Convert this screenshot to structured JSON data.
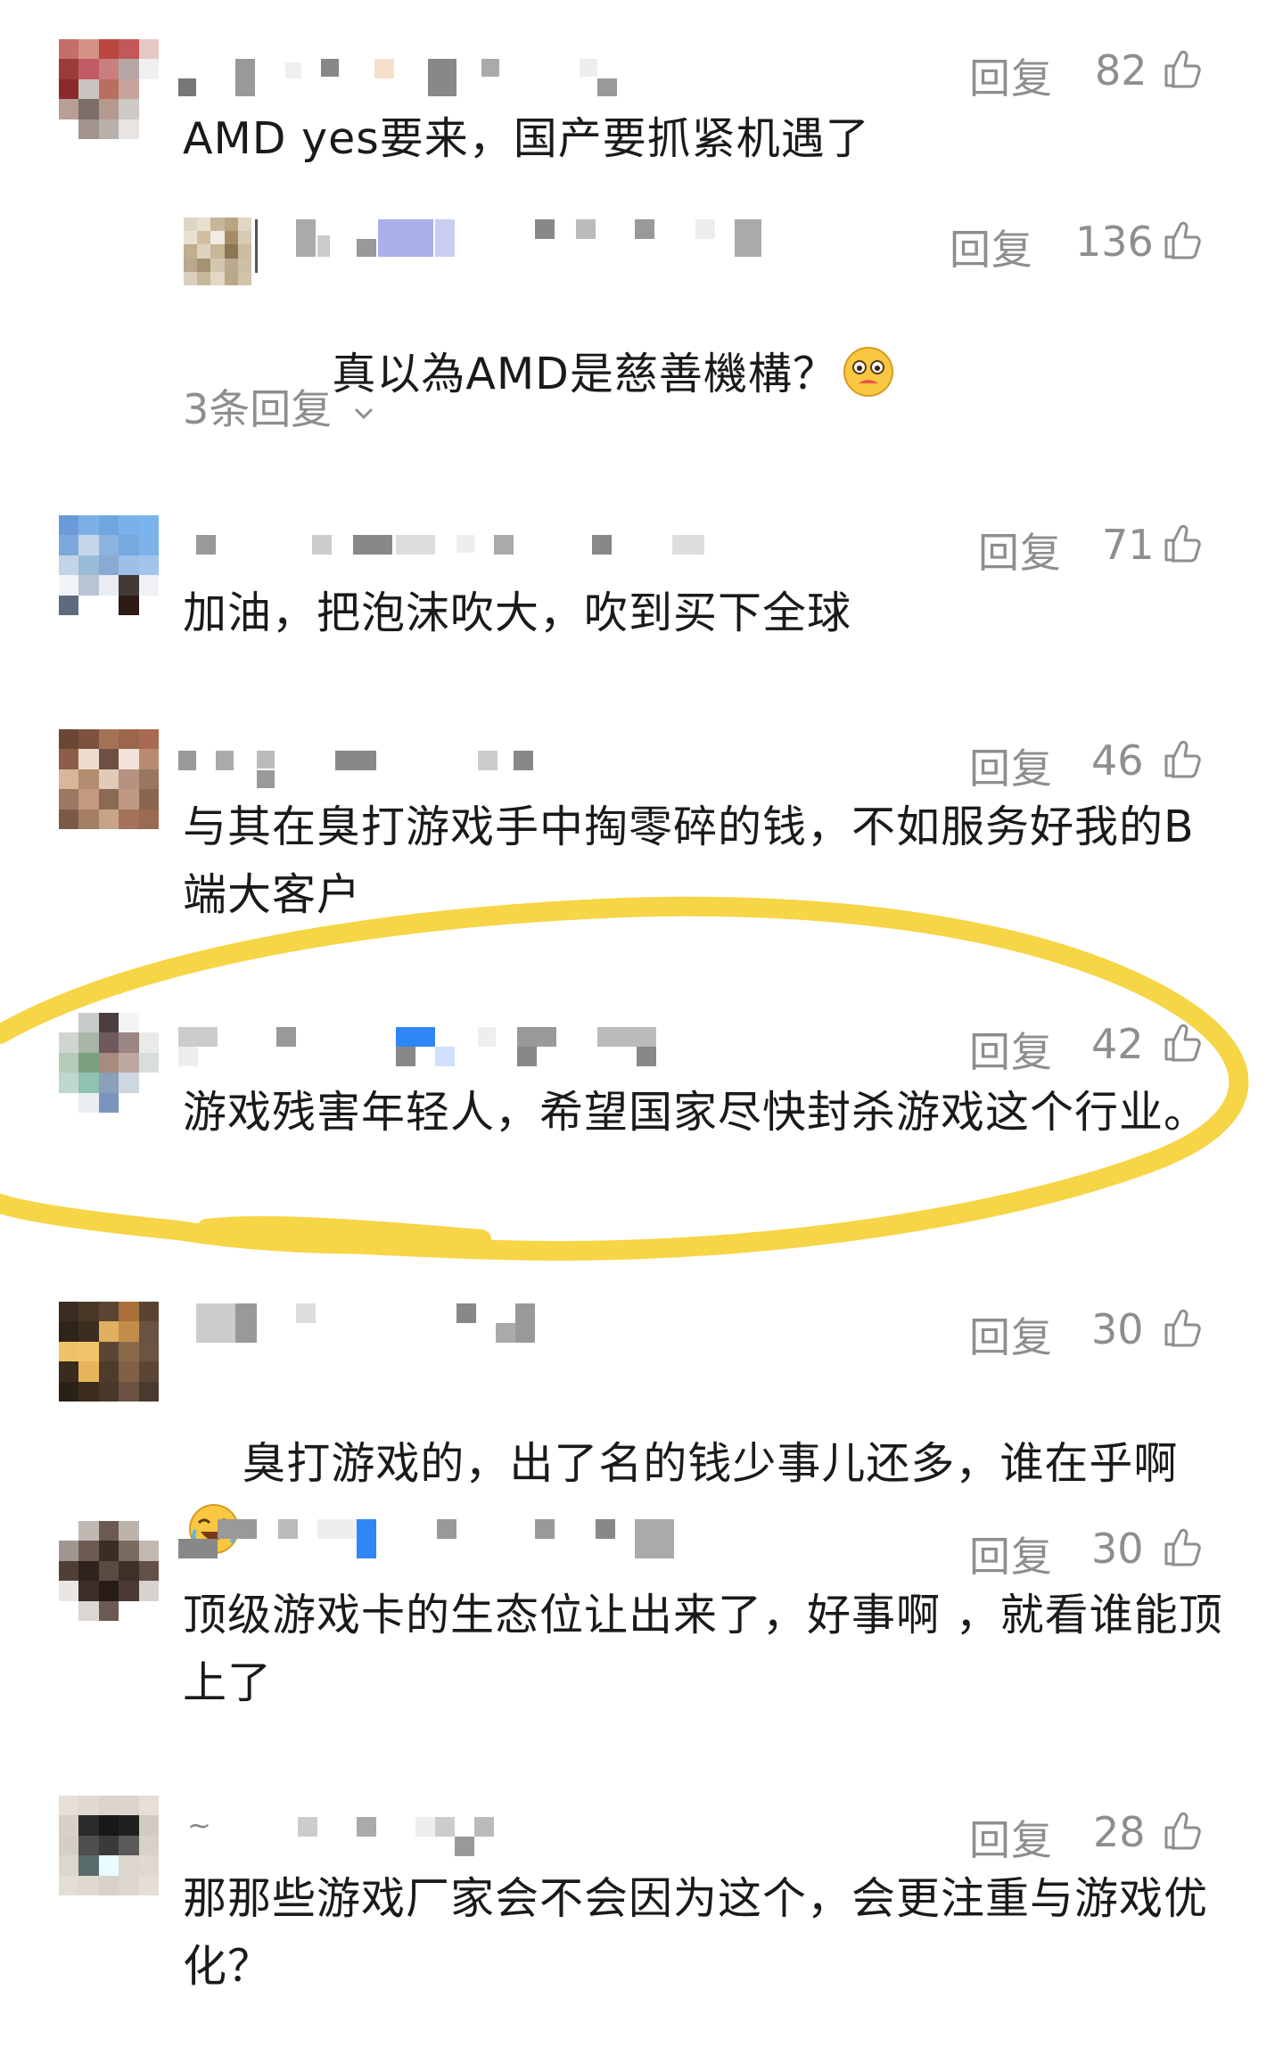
{
  "reply_label": "回复",
  "comments": [
    {
      "likes": "82",
      "text": "AMD yes要来，国产要抓紧机遇了",
      "more_replies": "3条回复"
    },
    {
      "likes": "71",
      "text": "加油，把泡沫吹大，吹到买下全球"
    },
    {
      "likes": "46",
      "text": "与其在臭打游戏手中掏零碎的钱，不如服务好我的B端大客户"
    },
    {
      "likes": "42",
      "text": "游戏残害年轻人，希望国家尽快封杀游戏这个行业。"
    },
    {
      "likes": "30",
      "text": "臭打游戏的，出了名的钱少事儿还多，谁在乎啊"
    },
    {
      "likes": "30",
      "text": "顶级游戏卡的生态位让出来了，好事啊 ，就看谁能顶上了"
    },
    {
      "likes": "28",
      "text": "那那些游戏厂家会不会因为这个，会更注重与游戏优化？",
      "name_prefix": "~"
    }
  ],
  "nested_reply": {
    "likes": "136",
    "text": "真以為AMD是慈善機構？"
  },
  "colors": {
    "text": "#1a1a1a",
    "meta": "#8e8e8e",
    "highlight": "#f6d33c"
  },
  "icons": [
    "thumbs-up-icon",
    "chevron-down-icon",
    "emoji-icon",
    "laughing-emoji-icon"
  ]
}
